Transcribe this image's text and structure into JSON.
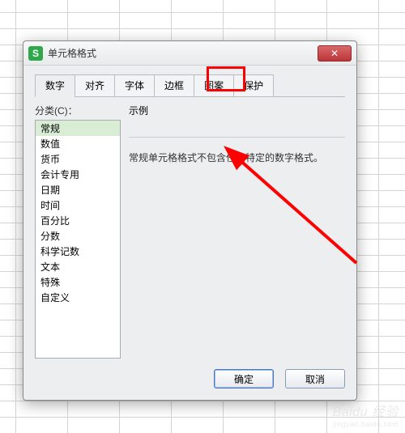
{
  "dialog": {
    "title": "单元格格式",
    "app_icon_letter": "S",
    "close_label": "✕"
  },
  "tabs": {
    "t0": "数字",
    "t1": "对齐",
    "t2": "字体",
    "t3": "边框",
    "t4": "图案",
    "t5": "保护"
  },
  "left": {
    "label": "分类(C)：",
    "items": {
      "c0": "常规",
      "c1": "数值",
      "c2": "货币",
      "c3": "会计专用",
      "c4": "日期",
      "c5": "时间",
      "c6": "百分比",
      "c7": "分数",
      "c8": "科学记数",
      "c9": "文本",
      "c10": "特殊",
      "c11": "自定义"
    }
  },
  "right": {
    "example_label": "示例",
    "description": "常规单元格格式不包含任何特定的数字格式。"
  },
  "buttons": {
    "ok": "确定",
    "cancel": "取消"
  },
  "annotation": {
    "highlight_target": "保护",
    "arrow_color": "#ff0000"
  },
  "watermark": {
    "main": "Baidu 经验",
    "sub": "jingyan.baidu.com"
  }
}
